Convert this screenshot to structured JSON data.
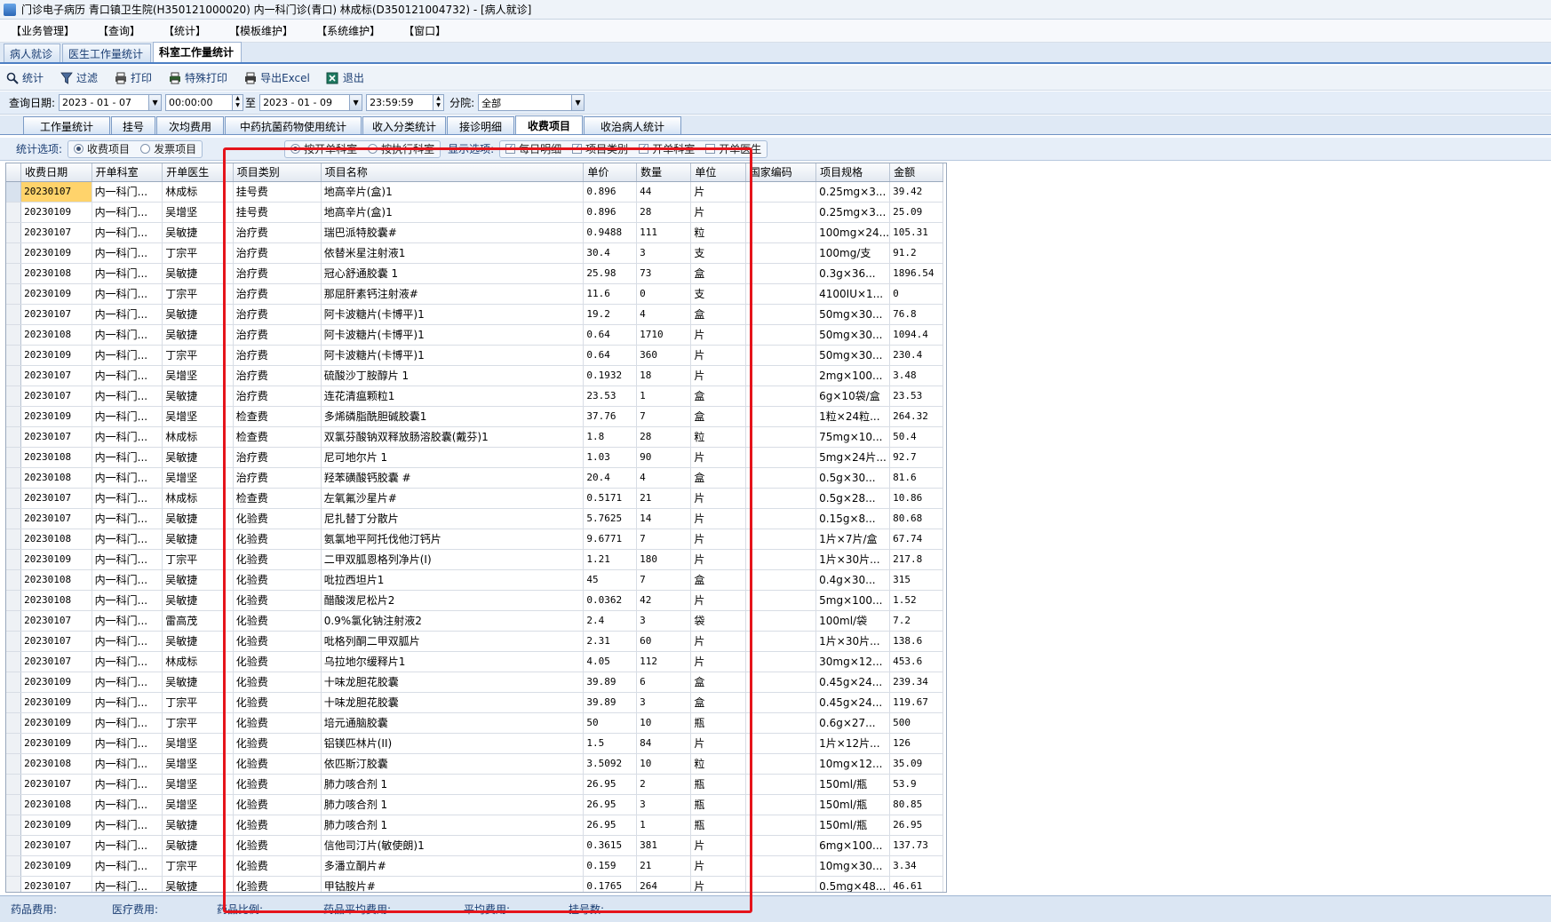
{
  "window": {
    "title": "门诊电子病历  青口镇卫生院(H350121000020)  内一科门诊(青口)  林成标(D350121004732) - [病人就诊]"
  },
  "menu": [
    "【业务管理】",
    "【查询】",
    "【统计】",
    "【模板维护】",
    "【系统维护】",
    "【窗口】"
  ],
  "doc_tabs": [
    {
      "label": "病人就诊",
      "active": false
    },
    {
      "label": "医生工作量统计",
      "active": false
    },
    {
      "label": "科室工作量统计",
      "active": true
    }
  ],
  "toolbar": [
    {
      "label": "统计",
      "icon": "magnifier-icon"
    },
    {
      "label": "过滤",
      "icon": "filter-icon"
    },
    {
      "label": "打印",
      "icon": "printer-icon"
    },
    {
      "label": "特殊打印",
      "icon": "special-print-icon"
    },
    {
      "label": "导出Excel",
      "icon": "export-excel-icon"
    },
    {
      "label": "退出",
      "icon": "exit-icon"
    }
  ],
  "query": {
    "date_label": "查询日期:",
    "start_date": "2023 - 01 - 07",
    "start_time": "00:00:00",
    "to_label": "至",
    "end_date": "2023 - 01 - 09",
    "end_time": "23:59:59",
    "branch_label": "分院:",
    "branch_value": "全部"
  },
  "function_tabs": [
    {
      "label": "工作量统计",
      "active": false
    },
    {
      "label": "挂号",
      "active": false
    },
    {
      "label": "次均费用",
      "active": false
    },
    {
      "label": "中药抗菌药物使用统计",
      "active": false
    },
    {
      "label": "收入分类统计",
      "active": false
    },
    {
      "label": "接诊明细",
      "active": false
    },
    {
      "label": "收费项目",
      "active": true
    },
    {
      "label": "收治病人统计",
      "active": false
    }
  ],
  "options": {
    "label": "统计选项:",
    "stat_radios": [
      {
        "label": "收费项目",
        "checked": true
      },
      {
        "label": "发票项目",
        "checked": false
      }
    ],
    "dept_radios": [
      {
        "label": "按开单科室",
        "checked": true
      },
      {
        "label": "按执行科室",
        "checked": false
      }
    ],
    "display_label": "显示选项:",
    "display_checks": [
      {
        "label": "每日明细",
        "checked": true
      },
      {
        "label": "项目类别",
        "checked": true
      },
      {
        "label": "开单科室",
        "checked": true
      },
      {
        "label": "开单医生",
        "checked": false
      }
    ]
  },
  "columns": [
    "收费日期",
    "开单科室",
    "开单医生",
    "项目类别",
    "项目名称",
    "单价",
    "数量",
    "单位",
    "国家编码",
    "项目规格",
    "金额"
  ],
  "rows": [
    [
      "20230107",
      "内一科门...",
      "林成标",
      "挂号费",
      "地高辛片(盒)1",
      "0.896",
      "44",
      "片",
      "",
      "0.25mg×3...",
      "39.42"
    ],
    [
      "20230109",
      "内一科门...",
      "吴增坚",
      "挂号费",
      "地高辛片(盒)1",
      "0.896",
      "28",
      "片",
      "",
      "0.25mg×3...",
      "25.09"
    ],
    [
      "20230107",
      "内一科门...",
      "吴敏捷",
      "治疗费",
      "瑞巴派特胶囊#",
      "0.9488",
      "111",
      "粒",
      "",
      "100mg×24...",
      "105.31"
    ],
    [
      "20230109",
      "内一科门...",
      "丁宗平",
      "治疗费",
      "依替米星注射液1",
      "30.4",
      "3",
      "支",
      "",
      "100mg/支",
      "91.2"
    ],
    [
      "20230108",
      "内一科门...",
      "吴敏捷",
      "治疗费",
      "冠心舒通胶囊 1",
      "25.98",
      "73",
      "盒",
      "",
      "0.3g×36...",
      "1896.54"
    ],
    [
      "20230109",
      "内一科门...",
      "丁宗平",
      "治疗费",
      "那屈肝素钙注射液#",
      "11.6",
      "0",
      "支",
      "",
      "4100IU×1...",
      "0"
    ],
    [
      "20230107",
      "内一科门...",
      "吴敏捷",
      "治疗费",
      "阿卡波糖片(卡博平)1",
      "19.2",
      "4",
      "盒",
      "",
      "50mg×30...",
      "76.8"
    ],
    [
      "20230108",
      "内一科门...",
      "吴敏捷",
      "治疗费",
      "阿卡波糖片(卡博平)1",
      "0.64",
      "1710",
      "片",
      "",
      "50mg×30...",
      "1094.4"
    ],
    [
      "20230109",
      "内一科门...",
      "丁宗平",
      "治疗费",
      "阿卡波糖片(卡博平)1",
      "0.64",
      "360",
      "片",
      "",
      "50mg×30...",
      "230.4"
    ],
    [
      "20230107",
      "内一科门...",
      "吴增坚",
      "治疗费",
      "硫酸沙丁胺醇片 1",
      "0.1932",
      "18",
      "片",
      "",
      "2mg×100...",
      "3.48"
    ],
    [
      "20230107",
      "内一科门...",
      "吴敏捷",
      "治疗费",
      "连花清瘟颗粒1",
      "23.53",
      "1",
      "盒",
      "",
      "6g×10袋/盒",
      "23.53"
    ],
    [
      "20230109",
      "内一科门...",
      "吴增坚",
      "检查费",
      "多烯磷脂酰胆碱胶囊1",
      "37.76",
      "7",
      "盒",
      "",
      "1粒×24粒...",
      "264.32"
    ],
    [
      "20230107",
      "内一科门...",
      "林成标",
      "检查费",
      "双氯芬酸钠双释放肠溶胶囊(戴芬)1",
      "1.8",
      "28",
      "粒",
      "",
      "75mg×10...",
      "50.4"
    ],
    [
      "20230108",
      "内一科门...",
      "吴敏捷",
      "治疗费",
      "尼可地尔片 1",
      "1.03",
      "90",
      "片",
      "",
      "5mg×24片...",
      "92.7"
    ],
    [
      "20230108",
      "内一科门...",
      "吴增坚",
      "治疗费",
      "羟苯磺酸钙胶囊 #",
      "20.4",
      "4",
      "盒",
      "",
      "0.5g×30...",
      "81.6"
    ],
    [
      "20230107",
      "内一科门...",
      "林成标",
      "检查费",
      "左氧氟沙星片#",
      "0.5171",
      "21",
      "片",
      "",
      "0.5g×28...",
      "10.86"
    ],
    [
      "20230107",
      "内一科门...",
      "吴敏捷",
      "化验费",
      "尼扎替丁分散片",
      "5.7625",
      "14",
      "片",
      "",
      "0.15g×8...",
      "80.68"
    ],
    [
      "20230108",
      "内一科门...",
      "吴敏捷",
      "化验费",
      "氨氯地平阿托伐他汀钙片",
      "9.6771",
      "7",
      "片",
      "",
      "1片×7片/盒",
      "67.74"
    ],
    [
      "20230109",
      "内一科门...",
      "丁宗平",
      "化验费",
      "二甲双胍恩格列净片(I)",
      "1.21",
      "180",
      "片",
      "",
      "1片×30片...",
      "217.8"
    ],
    [
      "20230108",
      "内一科门...",
      "吴敏捷",
      "化验费",
      "吡拉西坦片1",
      "45",
      "7",
      "盒",
      "",
      "0.4g×30...",
      "315"
    ],
    [
      "20230108",
      "内一科门...",
      "吴敏捷",
      "化验费",
      "醋酸泼尼松片2",
      "0.0362",
      "42",
      "片",
      "",
      "5mg×100...",
      "1.52"
    ],
    [
      "20230107",
      "内一科门...",
      "雷高茂",
      "化验费",
      "0.9%氯化钠注射液2",
      "2.4",
      "3",
      "袋",
      "",
      "100ml/袋",
      "7.2"
    ],
    [
      "20230107",
      "内一科门...",
      "吴敏捷",
      "化验费",
      "吡格列酮二甲双胍片",
      "2.31",
      "60",
      "片",
      "",
      "1片×30片...",
      "138.6"
    ],
    [
      "20230107",
      "内一科门...",
      "林成标",
      "化验费",
      "乌拉地尔缓释片1",
      "4.05",
      "112",
      "片",
      "",
      "30mg×12...",
      "453.6"
    ],
    [
      "20230109",
      "内一科门...",
      "吴敏捷",
      "化验费",
      "十味龙胆花胶囊",
      "39.89",
      "6",
      "盒",
      "",
      "0.45g×24...",
      "239.34"
    ],
    [
      "20230109",
      "内一科门...",
      "丁宗平",
      "化验费",
      "十味龙胆花胶囊",
      "39.89",
      "3",
      "盒",
      "",
      "0.45g×24...",
      "119.67"
    ],
    [
      "20230109",
      "内一科门...",
      "丁宗平",
      "化验费",
      "培元通脑胶囊",
      "50",
      "10",
      "瓶",
      "",
      "0.6g×27...",
      "500"
    ],
    [
      "20230109",
      "内一科门...",
      "吴增坚",
      "化验费",
      "铝镁匹林片(II)",
      "1.5",
      "84",
      "片",
      "",
      "1片×12片...",
      "126"
    ],
    [
      "20230108",
      "内一科门...",
      "吴增坚",
      "化验费",
      "依匹斯汀胶囊",
      "3.5092",
      "10",
      "粒",
      "",
      "10mg×12...",
      "35.09"
    ],
    [
      "20230107",
      "内一科门...",
      "吴增坚",
      "化验费",
      "肺力咳合剂 1",
      "26.95",
      "2",
      "瓶",
      "",
      "150ml/瓶",
      "53.9"
    ],
    [
      "20230108",
      "内一科门...",
      "吴增坚",
      "化验费",
      "肺力咳合剂 1",
      "26.95",
      "3",
      "瓶",
      "",
      "150ml/瓶",
      "80.85"
    ],
    [
      "20230109",
      "内一科门...",
      "吴敏捷",
      "化验费",
      "肺力咳合剂 1",
      "26.95",
      "1",
      "瓶",
      "",
      "150ml/瓶",
      "26.95"
    ],
    [
      "20230107",
      "内一科门...",
      "吴敏捷",
      "化验费",
      "信他司汀片(敏使朗)1",
      "0.3615",
      "381",
      "片",
      "",
      "6mg×100...",
      "137.73"
    ],
    [
      "20230109",
      "内一科门...",
      "丁宗平",
      "化验费",
      "多潘立酮片#",
      "0.159",
      "21",
      "片",
      "",
      "10mg×30...",
      "3.34"
    ],
    [
      "20230107",
      "内一科门...",
      "吴敏捷",
      "化验费",
      "甲钴胺片#",
      "0.1765",
      "264",
      "片",
      "",
      "0.5mg×48...",
      "46.61"
    ]
  ],
  "status": [
    {
      "label": "药品费用:"
    },
    {
      "label": "医疗费用:"
    },
    {
      "label": "药品比例:"
    },
    {
      "label": "药品平均费用:"
    },
    {
      "label": "平均费用:"
    },
    {
      "label": "挂号数:"
    }
  ],
  "colors": {
    "annotation": "#e5141b",
    "selected_cell": "#ffd36b",
    "tab_border": "#4d7fc4"
  }
}
